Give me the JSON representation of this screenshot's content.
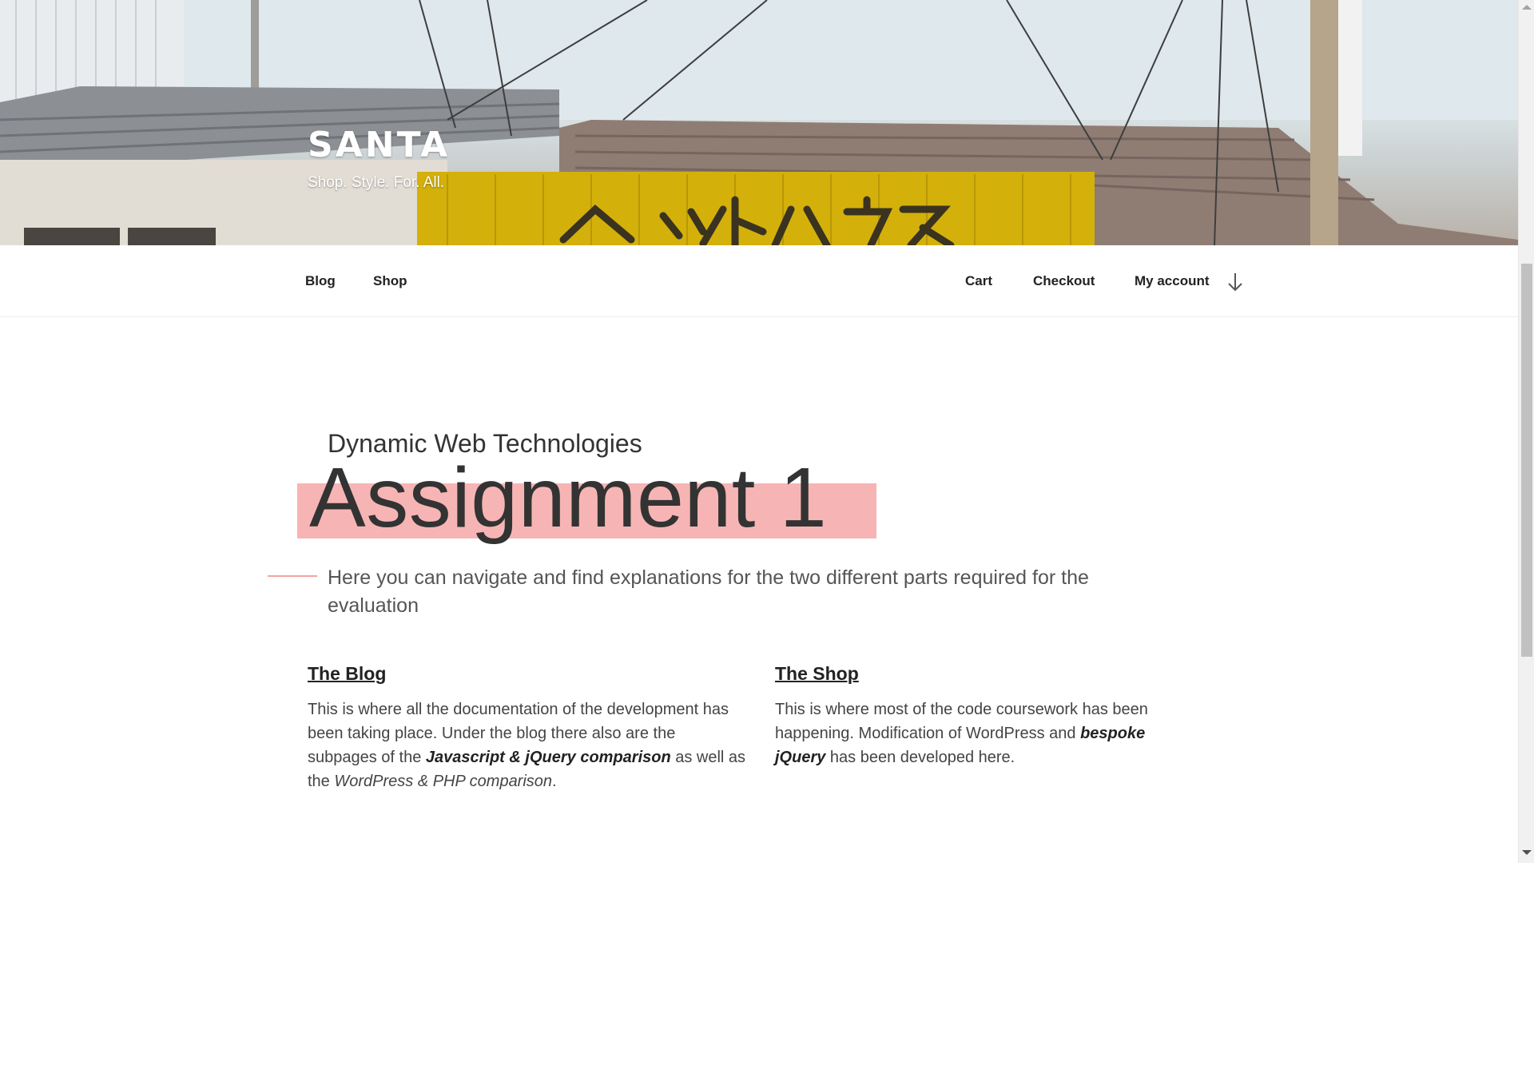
{
  "header": {
    "site_title": "SANTA",
    "tagline": "Shop. Style. For. All."
  },
  "nav": {
    "left_items": [
      "Blog",
      "Shop"
    ],
    "right_items": [
      "Cart",
      "Checkout",
      "My account"
    ],
    "scroll_icon": "arrow-down-icon"
  },
  "main": {
    "subtitle": "Dynamic Web Technologies",
    "title": "Assignment 1",
    "intro": "Here you can navigate and find explanations for the two different parts required for the evaluation",
    "columns": [
      {
        "heading": "The Blog",
        "text_1": "This is where all the documentation of the development has been taking place. Under the blog there also are the subpages of the ",
        "bold_1": "Javascript & jQuery comparison",
        "text_2": " as well as the ",
        "italic_1": "WordPress & PHP comparison",
        "text_3": "."
      },
      {
        "heading": "The Shop",
        "text_1": "This is where most of the code coursework has been happening. Modification of WordPress and ",
        "bold_1": "bespoke jQuery",
        "text_2": " has been developed here."
      }
    ]
  },
  "colors": {
    "highlight": "#f6b5b4",
    "accent_line": "#f4a4a2",
    "sign_yellow": "#d4b00a"
  }
}
